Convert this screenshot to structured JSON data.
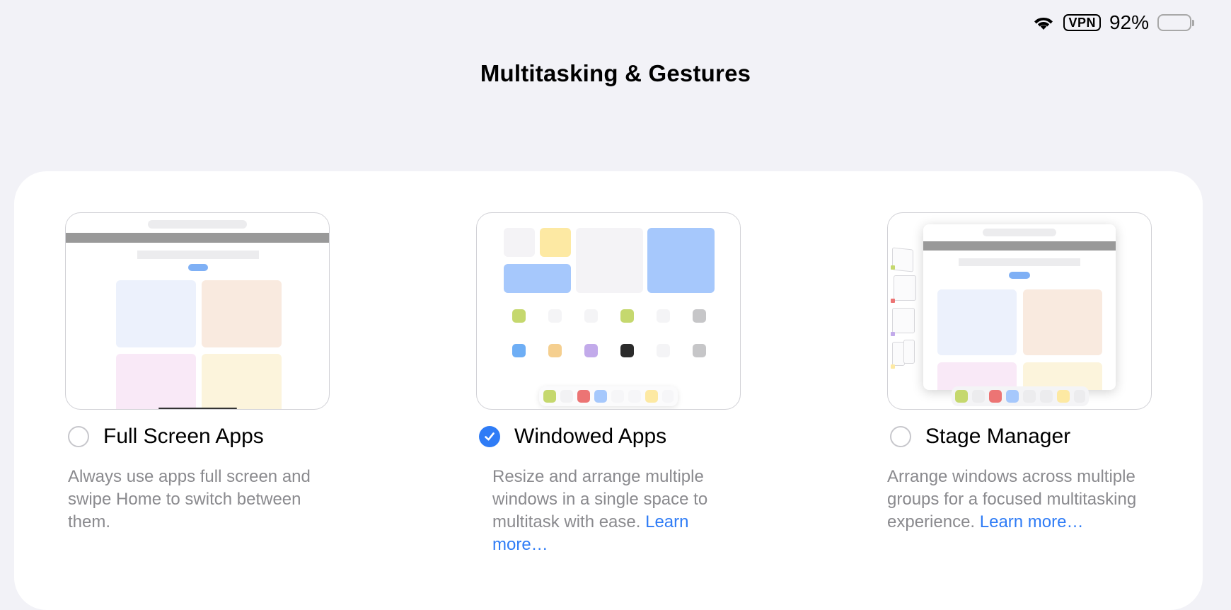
{
  "status_bar": {
    "wifi_icon": "wifi-icon",
    "vpn_label": "VPN",
    "battery_percent": "92%",
    "battery_level": 0.92
  },
  "page": {
    "title": "Multitasking & Gestures"
  },
  "options": [
    {
      "label": "Full Screen Apps",
      "selected": false,
      "description": "Always use apps full screen and swipe Home to switch between them.",
      "link": ""
    },
    {
      "label": "Windowed Apps",
      "selected": true,
      "description": "Resize and arrange multiple windows in a single space to multitask with ease. ",
      "link": "Learn more…"
    },
    {
      "label": "Stage Manager",
      "selected": false,
      "description": "Arrange windows across multiple groups for a focused multitasking experience. ",
      "link": "Learn more…"
    }
  ],
  "colors": {
    "accent": "#2f7cf6",
    "background": "#f2f2f7",
    "card": "#ffffff",
    "secondary_text": "#8a8a8e"
  }
}
